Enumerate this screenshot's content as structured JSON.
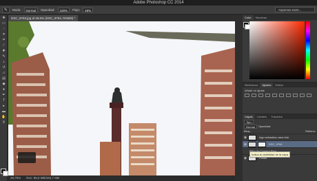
{
  "app": {
    "title": "Adobe Photoshop CC 2014"
  },
  "options": {
    "mode_label": "Modo:",
    "mode_value": "Normal",
    "opacity_label": "Opacidad:",
    "opacity_value": "100%",
    "flow_label": "Flujo:",
    "flow_value": "48%",
    "workspace": "Aspectos esen..."
  },
  "document": {
    "tab_title": "DSC_9763.jpg al 28,6% (DSC_9764, RGB/8) *"
  },
  "status": {
    "zoom": "28,76%",
    "doc": "Doc: 86,6 MB/184,7 MB"
  },
  "color_panel": {
    "tabs": [
      "Color",
      "Muestras"
    ]
  },
  "adj_panel": {
    "tabs": [
      "Bibliotecas",
      "Ajustes",
      "Estilos"
    ],
    "label": "Añadir un ajuste"
  },
  "layers_panel": {
    "tabs": [
      "Capas",
      "Canales",
      "Trazados"
    ],
    "filter": "Tipo",
    "blend_mode": "Normal",
    "opacity_label": "Opacidad:",
    "lock_label": "Bloq.:",
    "fill_label": "Relleno:",
    "layers": [
      "logo sebastian vaca fotó",
      "DSC_9764",
      "Filtro de Camera Raw",
      "Fondo"
    ],
    "tooltip": "Indica la visibilidad de la capa"
  }
}
